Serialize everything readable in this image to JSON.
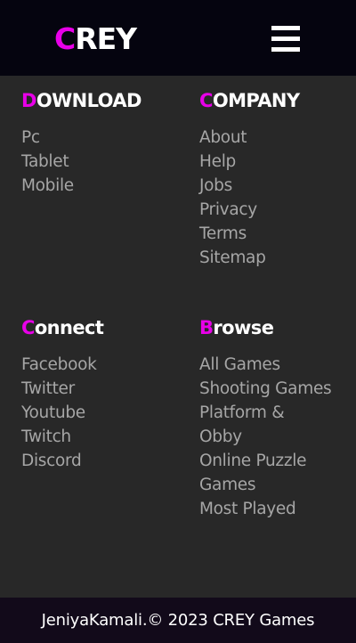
{
  "header": {
    "logo_first": "C",
    "logo_rest": "REY",
    "menu_icon": "hamburger-menu-icon"
  },
  "sections": {
    "download": {
      "title_first": "D",
      "title_rest": "OWNLOAD",
      "links": [
        "Pc",
        "Tablet",
        "Mobile"
      ]
    },
    "company": {
      "title_first": "C",
      "title_rest": "OMPANY",
      "links": [
        "About",
        "Help",
        "Jobs",
        "Privacy",
        "Terms",
        "Sitemap"
      ]
    },
    "connect": {
      "title_first": "C",
      "title_rest": "onnect",
      "links": [
        "Facebook",
        "Twitter",
        "Youtube",
        "Twitch",
        "Discord"
      ]
    },
    "browse": {
      "title_first": "B",
      "title_rest": "rowse",
      "links": [
        "All Games",
        "Shooting Games",
        "Platform &",
        "Obby",
        "Online Puzzle",
        "Games",
        "Most Played"
      ]
    }
  },
  "footer": {
    "copyright": "JeniyaKamali.© 2023 CREY Games"
  },
  "colors": {
    "accent": "#e800e8",
    "header_bg": "#05040f",
    "body_bg": "#282828",
    "footer_bg": "#120a1a",
    "link": "#a6a6a6"
  }
}
